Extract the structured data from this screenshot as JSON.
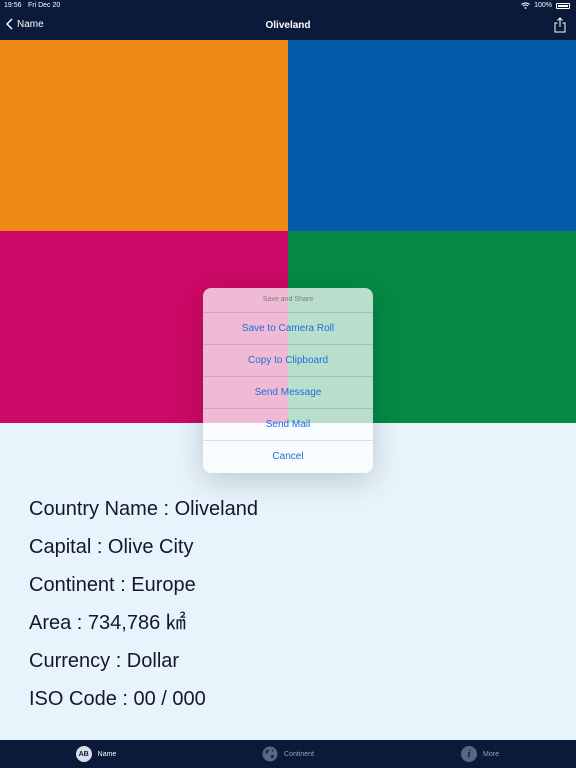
{
  "status": {
    "time": "19:56",
    "date": "Fri Dec 20",
    "battery": "100%"
  },
  "nav": {
    "back_label": "Name",
    "title": "Oliveland"
  },
  "flag": {
    "colors": [
      "#f08a17",
      "#025aa8",
      "#cc0966",
      "#048a45"
    ]
  },
  "share_sheet": {
    "title": "Save and Share",
    "actions": [
      "Save to Camera Roll",
      "Copy to Clipboard",
      "Send Message",
      "Send Mail",
      "Cancel"
    ]
  },
  "info": [
    "Country Name : Oliveland",
    "Capital : Olive City",
    "Continent : Europe",
    "Area : 734,786 ㎢",
    "Currency : Dollar",
    "ISO Code : 00 / 000"
  ],
  "tabs": [
    {
      "label": "Name",
      "icon": "name-icon",
      "selected": true
    },
    {
      "label": "Continent",
      "icon": "globe-icon",
      "selected": false
    },
    {
      "label": "More",
      "icon": "info-icon",
      "selected": false
    }
  ],
  "colors": {
    "bar": "#0c1a3a",
    "tab_active": "#ffffff",
    "tab_inactive": "#9aa3b8",
    "action": "#1b6fe0"
  }
}
